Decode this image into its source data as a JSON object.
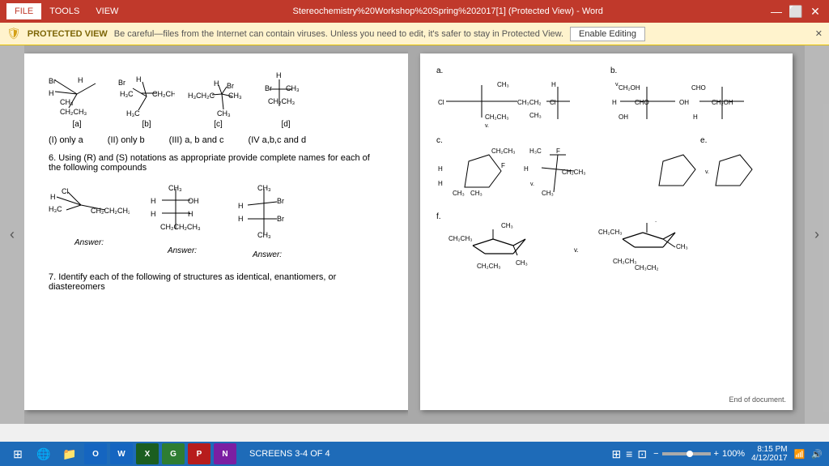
{
  "titlebar": {
    "tabs": [
      "FILE",
      "TOOLS",
      "VIEW"
    ],
    "active_tab": "FILE",
    "title": "Stereochemistry%20Workshop%20Spring%202017[1] (Protected View) - Word",
    "controls": [
      "⊡",
      "—",
      "⬜",
      "✕"
    ]
  },
  "protected_bar": {
    "label": "PROTECTED VIEW",
    "message": "Be careful—files from the Internet can contain viruses. Unless you need to edit, it's safer to stay in Protected View.",
    "enable_btn": "Enable Editing"
  },
  "left_page": {
    "structures": [
      {
        "label": "[a]",
        "id": "struct-a"
      },
      {
        "label": "[b]",
        "id": "struct-b"
      },
      {
        "label": "[c]",
        "id": "struct-c"
      },
      {
        "label": "[d]",
        "id": "struct-d"
      }
    ],
    "options": [
      {
        "id": "opt1",
        "text": "(I) only a"
      },
      {
        "id": "opt2",
        "text": "(II) only b"
      },
      {
        "id": "opt3",
        "text": "(III) a, b and  c"
      },
      {
        "id": "opt4",
        "text": "(IV a,b,c and d"
      }
    ],
    "question6": "6. Using (R) and (S) notations as appropriate provide complete names for each of the following compounds",
    "compounds": [
      {
        "label": "Answer:"
      },
      {
        "label": "Answer:"
      },
      {
        "label": "Answer:"
      }
    ],
    "question7": "7. Identify each of the following of structures as identical, enantiomers, or diastereomers"
  },
  "right_page": {
    "sections": [
      "a.",
      "b.",
      "c.",
      "e.",
      "f."
    ],
    "end_of_document": "End of document."
  },
  "status_bar": {
    "screens": "SCREENS 3-4 OF 4",
    "zoom": "100%",
    "time": "8:15 PM",
    "date": "4/12/2017"
  }
}
